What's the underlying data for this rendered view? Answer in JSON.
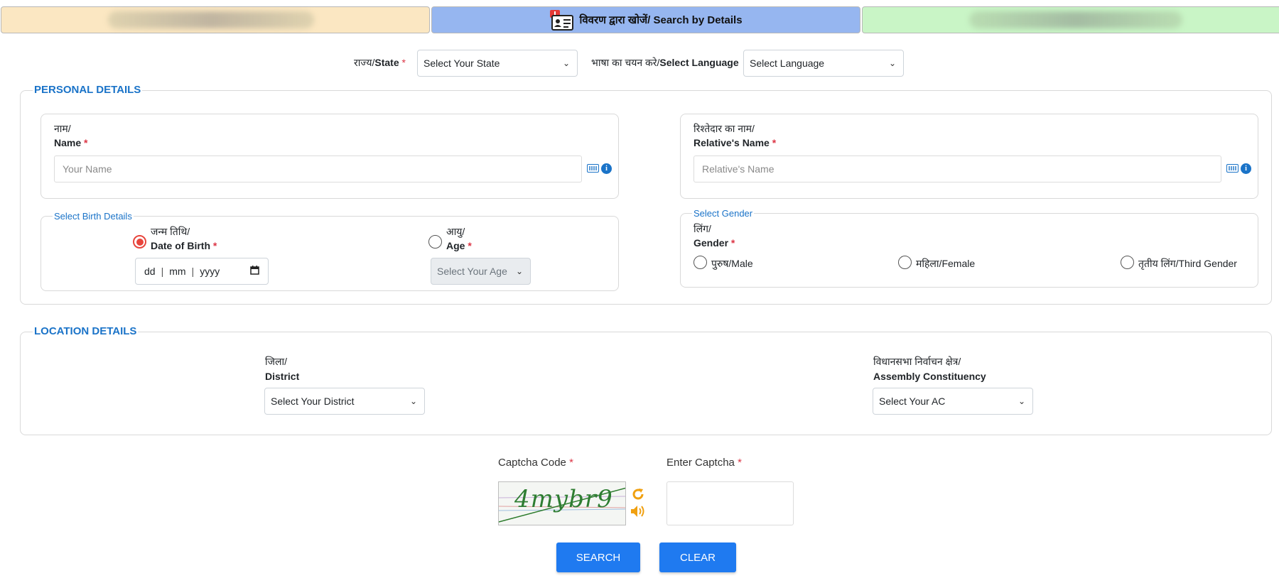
{
  "tabs": {
    "left_label": "",
    "active_label": "विवरण द्वारा खोजें/ Search by Details",
    "right_label": ""
  },
  "top": {
    "state_label_hi": "राज्य/",
    "state_label_en": "State",
    "state_select": "Select Your State",
    "language_label_hi": "भाषा का चयन करे/",
    "language_label_en": "Select Language",
    "language_select": "Select Language",
    "required_mark": "*"
  },
  "personal": {
    "legend": "PERSONAL DETAILS",
    "name_label_hi": "नाम/",
    "name_label_en": "Name",
    "name_placeholder": "Your Name",
    "relative_label_hi": "रिश्तेदार का नाम/",
    "relative_label_en": "Relative's Name",
    "relative_placeholder": "Relative's Name",
    "birth_legend": "Select Birth Details",
    "dob_label_hi": "जन्म तिथि/",
    "dob_label_en": "Date of Birth",
    "dob_dd": "dd",
    "dob_mm": "mm",
    "dob_yyyy": "yyyy",
    "age_label_hi": "आयु/",
    "age_label_en": "Age",
    "age_select": "Select Your Age",
    "gender_legend": "Select Gender",
    "gender_label_hi": "लिंग/",
    "gender_label_en": "Gender",
    "gender_male": "पुरुष/Male",
    "gender_female": "महिला/Female",
    "gender_third": "तृतीय लिंग/Third Gender"
  },
  "location": {
    "legend": "LOCATION DETAILS",
    "district_label_hi": "जिला/",
    "district_label_en": "District",
    "district_select": "Select Your District",
    "ac_label_hi": "विधानसभा निर्वाचन क्षेत्र/",
    "ac_label_en": "Assembly Constituency",
    "ac_select": "Select Your AC"
  },
  "captcha": {
    "code_label": "Captcha Code",
    "enter_label": "Enter Captcha",
    "image_text": "4mybr9",
    "input_value": ""
  },
  "buttons": {
    "search": "SEARCH",
    "clear": "CLEAR"
  },
  "colors": {
    "accent": "#1f7af0",
    "legend_blue": "#1a73c8",
    "required": "#dc3545",
    "radio_checked": "#e8453c",
    "tab_left": "#fbe7c2",
    "tab_active": "#96b6f0",
    "tab_right": "#c9f5c6",
    "captcha_icon": "#f0a010"
  },
  "icons": {
    "tab": "voter-id-card-icon",
    "keyboard": "keyboard-icon",
    "info": "info-icon",
    "refresh": "refresh-icon",
    "audio": "speaker-icon",
    "calendar": "calendar-icon",
    "chevron": "chevron-down-icon"
  }
}
